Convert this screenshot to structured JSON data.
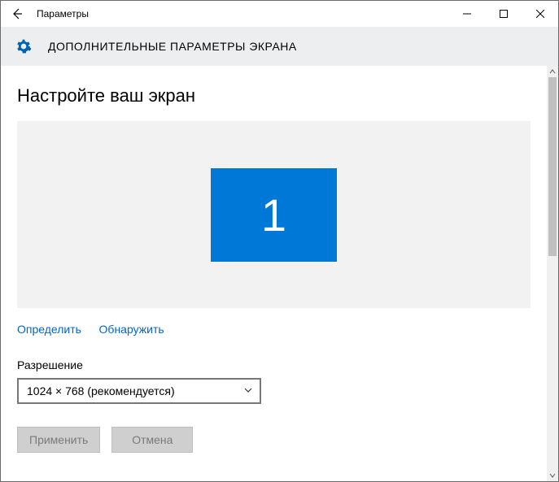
{
  "window": {
    "title": "Параметры"
  },
  "subheader": {
    "title": "ДОПОЛНИТЕЛЬНЫЕ ПАРАМЕТРЫ ЭКРАНА"
  },
  "page": {
    "heading": "Настройте ваш экран",
    "monitor_label": "1",
    "links": {
      "identify": "Определить",
      "detect": "Обнаружить"
    },
    "resolution": {
      "label": "Разрешение",
      "value": "1024 × 768 (рекомендуется)"
    },
    "buttons": {
      "apply": "Применить",
      "cancel": "Отмена"
    }
  }
}
